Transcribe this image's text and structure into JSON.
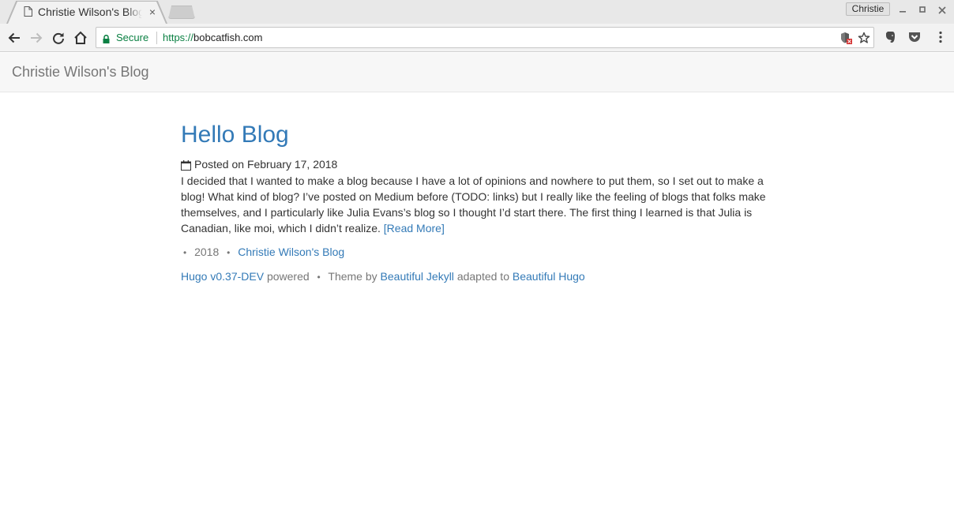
{
  "browser": {
    "tab": {
      "title": "Christie Wilson's Blog",
      "icon": "document-icon",
      "close_glyph": "×"
    },
    "profile_name": "Christie",
    "window_controls": {
      "minimize_glyph": "‒",
      "maximize_glyph": "▫",
      "close_glyph": "✕"
    },
    "omnibox": {
      "security_label": "Secure",
      "url_scheme": "https://",
      "url_host": "bobcatfish.com"
    },
    "colors": {
      "secure_green": "#0b8043",
      "link_blue": "#337ab7"
    }
  },
  "site": {
    "navbar_brand": "Christie Wilson's Blog",
    "page_heading": "Christie Wilson's Blog"
  },
  "post": {
    "title": "Hello Blog",
    "meta": "Posted on February 17, 2018",
    "excerpt": "I decided that I wanted to make a blog because I have a lot of opinions and nowhere to put them, so I set out to make a blog! What kind of blog? I’ve posted on Medium before (TODO: links) but I really like the feeling of blogs that folks make themselves, and I particularly like Julia Evans’s blog so I thought I’d start there. The first thing I learned is that Julia is Canadian, like moi, which I didn’t realize.",
    "read_more": "[Read More]"
  },
  "footer": {
    "separator": "•",
    "year": "2018",
    "site_link": "Christie Wilson's Blog",
    "hugo_link": "Hugo v0.37-DEV",
    "powered_text": "powered",
    "theme_by_text": "Theme by",
    "jekyll_link": "Beautiful Jekyll",
    "adapted_text": "adapted to",
    "hugo_theme_link": "Beautiful Hugo"
  }
}
